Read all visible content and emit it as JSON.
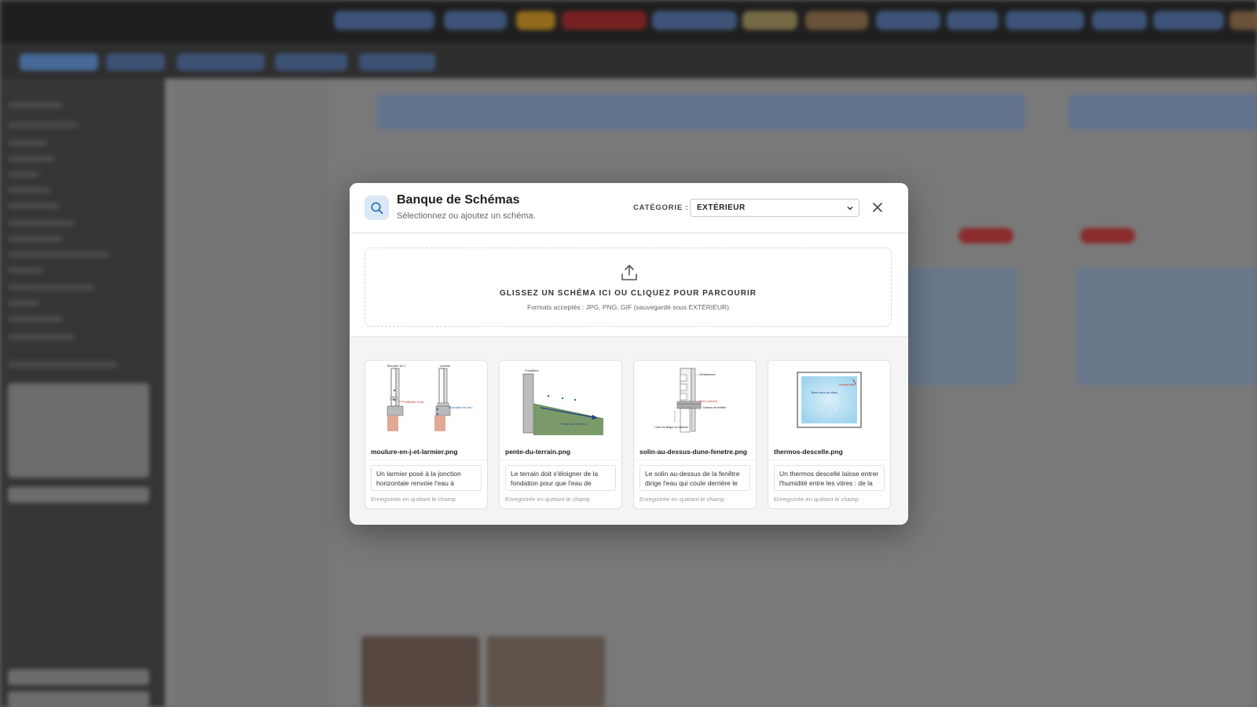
{
  "modal": {
    "title": "Banque de Schémas",
    "subtitle": "Sélectionnez ou ajoutez un schéma.",
    "category_label": "CATÉGORIE :",
    "category_value": "EXTÉRIEUR",
    "header_icon": "search-icon",
    "close_icon": "close-icon"
  },
  "upload": {
    "icon": "upload-icon",
    "title": "GLISSEZ UN SCHÉMA ICI OU CLIQUEZ POUR PARCOURIR",
    "subtitle": "Formats acceptés : JPG, PNG, GIF (sauvegardé sous EXTÉRIEUR)"
  },
  "cards": [
    {
      "filename": "moulure-en-j-et-larmier.png",
      "description": "Un larmier posé à la jonction horizontale renvoie l'eau à l'extérieur du revêtement au lieu de",
      "save_note": "Enregistrée en quittant le champ",
      "diagram_labels": [
        "Moulure en J",
        "Larmier",
        "Infiltration d'eau",
        "Évacuation de l'eau"
      ]
    },
    {
      "filename": "pente-du-terrain.png",
      "description": "Le terrain doit s'éloigner de la fondation pour que l'eau de surface s'écoule loin de la fondation",
      "save_note": "Enregistrée en quittant le champ",
      "diagram_labels": [
        "Fondation",
        "Pente vers l'extérieur"
      ]
    },
    {
      "filename": "solin-au-dessus-dune-fenetre.png",
      "description": "Le solin au-dessus de la fenêtre dirige l'eau qui coule derrière le revêtement vers l'extérieur",
      "save_note": "Enregistrée en quittant le champ",
      "diagram_labels": [
        "Revêtement",
        "Solin (larmier)",
        "Dessus de fenêtre",
        "L'eau est dirigée à l'extérieur"
      ]
    },
    {
      "filename": "thermos-descelle.png",
      "description": "Un thermos descellé laisse entrer l'humidité entre les vitres : de la buée se forme entre les vitres",
      "save_note": "Enregistrée en quittant le champ",
      "diagram_labels": [
        "Scellant brisé",
        "Buée entre les vitres"
      ]
    }
  ],
  "colors": {
    "accent": "#2b6cb0",
    "icon_bg": "#dbe8f6",
    "diagram_red": "#c0392b",
    "diagram_green": "#7a9a6a",
    "diagram_brick": "#e2a898"
  }
}
